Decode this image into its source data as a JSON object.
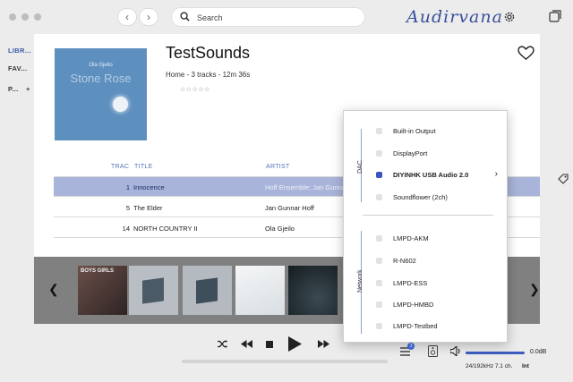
{
  "search": {
    "placeholder": "Search"
  },
  "app": {
    "logo": "Audirvana"
  },
  "sidebar": {
    "items": [
      {
        "label": "LIBR..."
      },
      {
        "label": "FAV..."
      },
      {
        "label": "P..."
      }
    ],
    "add_label": "+"
  },
  "album": {
    "cover_artist": "Ola Gjeilo",
    "cover_title": "Stone Rose",
    "title": "TestSounds",
    "meta": "Home  -  3 tracks - 12m 36s",
    "rating": "☆☆☆☆☆"
  },
  "table": {
    "headers": {
      "track": "TRAC",
      "title": "TITLE",
      "artist": "ARTIST"
    },
    "rows": [
      {
        "num": "1",
        "title": "Innocence",
        "artist": "Hoff Ensemble; Jan Gunnar",
        "selected": true
      },
      {
        "num": "5",
        "title": "The Elder",
        "artist": "Jan Gunnar Hoff",
        "selected": false
      },
      {
        "num": "14",
        "title": "NORTH COUNTRY II",
        "artist": "Ola Gjeilo",
        "selected": false
      }
    ]
  },
  "carousel": {
    "first_thumb_text": "BOYS GIRLS",
    "thumb_colors": [
      "#4a3a38",
      "#b8bec4",
      "#b4bac0",
      "#e8ecee",
      "#1e2a30"
    ]
  },
  "player": {
    "queue_count": "3",
    "volume_label": "0.0dB",
    "volume_level": 1.0,
    "format": "24/192kHz 7.1 ch.",
    "mode": "Int",
    "progress": 0
  },
  "output_menu": {
    "dac_label": "DAC",
    "network_label": "Network",
    "dac_devices": [
      {
        "label": "Built-in Output",
        "selected": false,
        "bold": false
      },
      {
        "label": "DisplayPort",
        "selected": false,
        "bold": false
      },
      {
        "label": "DIYINHK USB Audio 2.0",
        "selected": true,
        "bold": true,
        "submenu": true
      },
      {
        "label": "Soundflower (2ch)",
        "selected": false,
        "bold": false
      }
    ],
    "network_devices": [
      {
        "label": "LMPD-AKM"
      },
      {
        "label": "R-N602"
      },
      {
        "label": "LMPD-ESS"
      },
      {
        "label": "LMPD-HMBD"
      },
      {
        "label": "LMPD-Testbed"
      }
    ]
  },
  "colors": {
    "accent": "#3a55c0",
    "selected_row": "#a8b4d9",
    "header_text": "#5372b7",
    "cover": "#5d8fbf"
  }
}
